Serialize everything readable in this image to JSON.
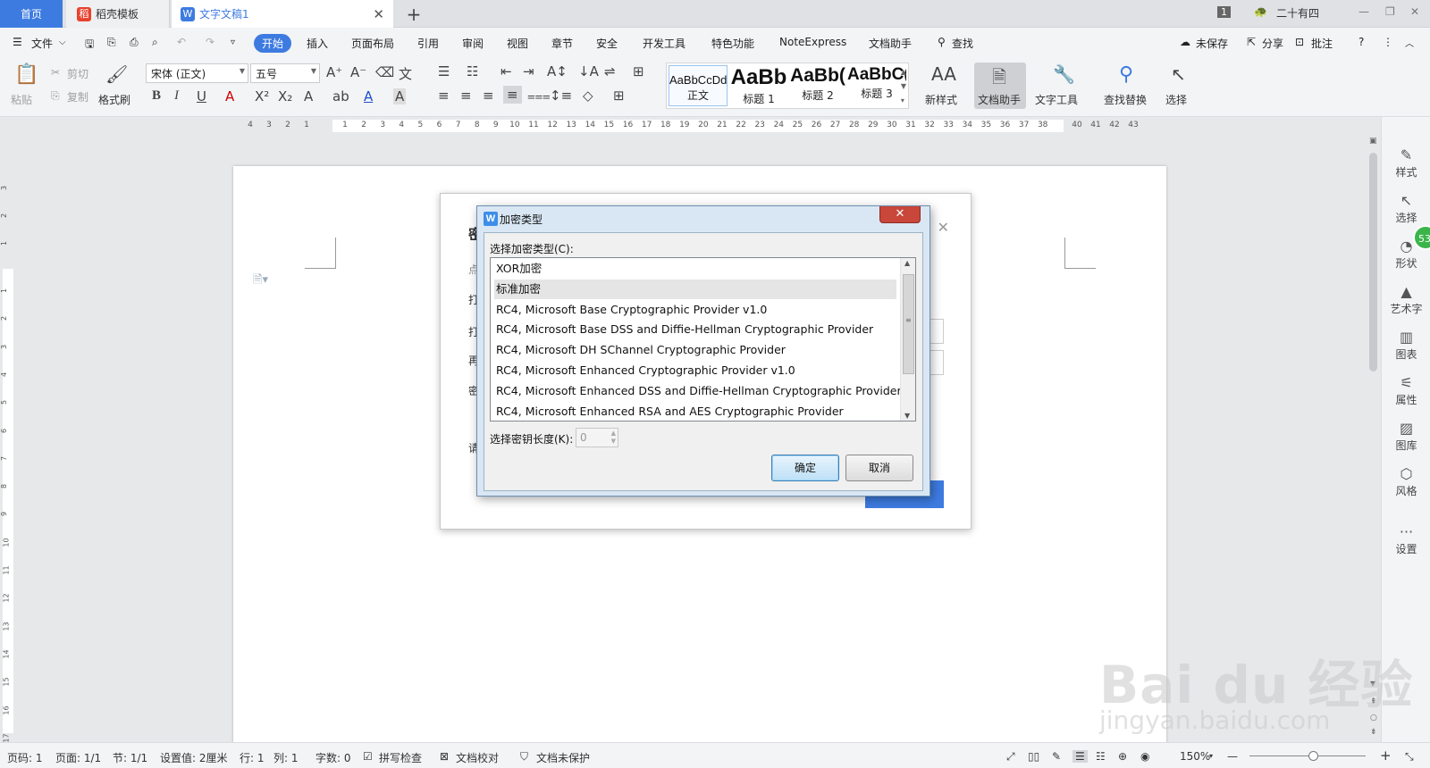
{
  "tabs": {
    "home": "首页",
    "template": "稻壳模板",
    "doc": "文字文稿1",
    "add": "+",
    "badge": "1",
    "user": "二十有四"
  },
  "menu": {
    "file": "文件",
    "items": [
      "开始",
      "插入",
      "页面布局",
      "引用",
      "审阅",
      "视图",
      "章节",
      "安全",
      "开发工具",
      "特色功能",
      "NoteExpress",
      "文档助手"
    ],
    "search": "查找",
    "unsaved": "未保存",
    "share": "分享",
    "comment": "批注"
  },
  "ribbon": {
    "paste": "粘贴",
    "cut": "剪切",
    "copy": "复制",
    "format_painter": "格式刷",
    "font_name": "宋体 (正文)",
    "font_size": "五号",
    "styles": [
      {
        "preview": "AaBbCcDd",
        "label": "正文"
      },
      {
        "preview": "AaBb",
        "label": "标题 1"
      },
      {
        "preview": "AaBb(",
        "label": "标题 2"
      },
      {
        "preview": "AaBbC(",
        "label": "标题 3"
      }
    ],
    "new_style": "新样式",
    "doc_assistant": "文档助手",
    "text_tools": "文字工具",
    "find_replace": "查找替换",
    "select": "选择"
  },
  "ruler_numbers": [
    "4",
    "3",
    "2",
    "1",
    "1",
    "2",
    "3",
    "4",
    "5",
    "6",
    "7",
    "8",
    "9",
    "10",
    "11",
    "12",
    "13",
    "14",
    "15",
    "16",
    "17",
    "18",
    "19",
    "20",
    "21",
    "22",
    "23",
    "24",
    "25",
    "26",
    "27",
    "28",
    "29",
    "30",
    "31",
    "32",
    "33",
    "34",
    "35",
    "36",
    "37",
    "38",
    "40",
    "41",
    "42",
    "43"
  ],
  "vruler_numbers": [
    "3",
    "2",
    "1",
    "1",
    "2",
    "3",
    "4",
    "5",
    "6",
    "7",
    "8",
    "9",
    "10",
    "11",
    "12",
    "13",
    "14",
    "15",
    "16",
    "17"
  ],
  "password_dialog_fragments": [
    "密",
    "点",
    "打",
    "打",
    "再",
    "密",
    "请"
  ],
  "enc_dialog": {
    "title": "加密类型",
    "list_label": "选择加密类型(C):",
    "items": [
      "XOR加密",
      "标准加密",
      "RC4, Microsoft Base Cryptographic Provider v1.0",
      "RC4, Microsoft Base DSS and Diffie-Hellman Cryptographic Provider",
      "RC4, Microsoft DH SChannel Cryptographic Provider",
      "RC4, Microsoft Enhanced Cryptographic Provider v1.0",
      "RC4, Microsoft Enhanced DSS and Diffie-Hellman Cryptographic Provider",
      "RC4, Microsoft Enhanced RSA and AES Cryptographic Provider"
    ],
    "selected_index": 1,
    "key_length_label": "选择密钥长度(K):",
    "key_length_value": "0",
    "ok": "确定",
    "cancel": "取消"
  },
  "right_panel": {
    "items": [
      "样式",
      "选择",
      "形状",
      "艺术字",
      "图表",
      "属性",
      "图库",
      "风格",
      "设置"
    ],
    "badge": "53"
  },
  "status": {
    "page_num": "页码: 1",
    "pages": "页面: 1/1",
    "section": "节: 1/1",
    "setting": "设置值: 2厘米",
    "row": "行: 1",
    "col": "列: 1",
    "words": "字数: 0",
    "spell": "拼写检查",
    "proof": "文档校对",
    "protect": "文档未保护",
    "zoom": "150%"
  },
  "watermark": {
    "brand": "Bai du 经验",
    "url": "jingyan.baidu.com"
  },
  "colors": {
    "accent": "#3d7be0",
    "close_red": "#c8463a",
    "badge_green": "#3bb54a"
  }
}
